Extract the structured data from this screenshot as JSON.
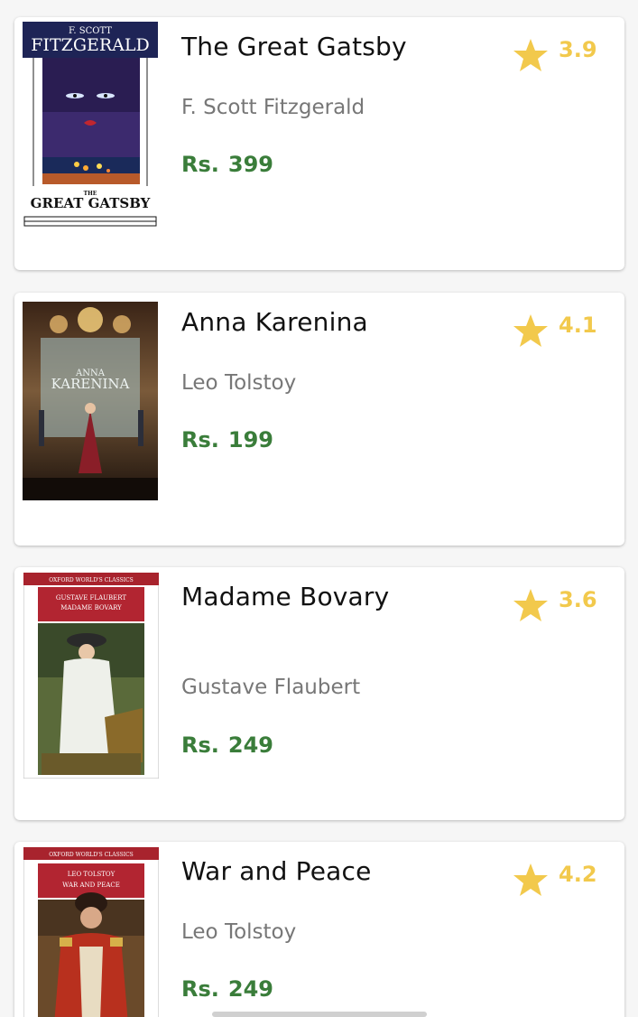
{
  "books": [
    {
      "title": "The Great Gatsby",
      "author": "F. Scott Fitzgerald",
      "currency": "Rs.",
      "price": "399",
      "rating": "3.9",
      "cover": {
        "top_line": "F. SCOTT",
        "author_line": "FITZGERALD",
        "small_line": "THE",
        "title_line": "GREAT GATSBY"
      }
    },
    {
      "title": "Anna Karenina",
      "author": "Leo Tolstoy",
      "currency": "Rs.",
      "price": "199",
      "rating": "4.1",
      "cover": {
        "line1": "ANNA",
        "line2": "KARENINA"
      }
    },
    {
      "title": "Madame Bovary",
      "author": "Gustave Flaubert",
      "currency": "Rs.",
      "price": "249",
      "rating": "3.6",
      "cover": {
        "series": "OXFORD WORLD'S CLASSICS",
        "author_line": "GUSTAVE FLAUBERT",
        "title_line": "MADAME BOVARY"
      }
    },
    {
      "title": "War and Peace",
      "author": "Leo Tolstoy",
      "currency": "Rs.",
      "price": "249",
      "rating": "4.2",
      "cover": {
        "series": "OXFORD WORLD'S CLASSICS",
        "author_line": "LEO TOLSTOY",
        "title_line": "WAR AND PEACE"
      }
    }
  ],
  "colors": {
    "price": "#3a7d3a",
    "rating": "#f2c94c",
    "title": "#111111",
    "author": "#777777"
  },
  "icons": {
    "rating": "star-icon"
  }
}
